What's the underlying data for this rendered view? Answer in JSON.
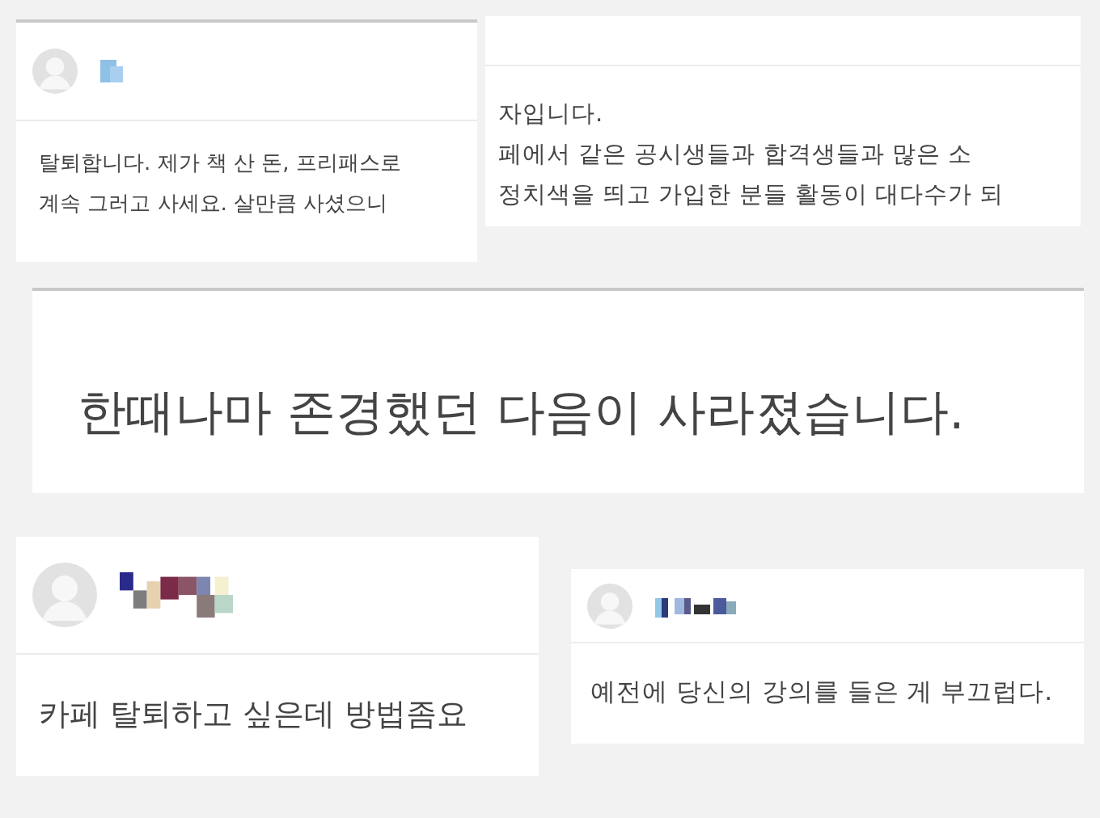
{
  "posts": [
    {
      "kind": "comment",
      "lines": [
        "탈퇴합니다. 제가 책 산 돈, 프리패스로",
        "계속 그러고 사세요. 살만큼 사셨으니"
      ]
    },
    {
      "kind": "excerpt",
      "lines": [
        "자입니다.",
        "페에서 같은 공시생들과 합격생들과 많은 소",
        "정치색을 띄고 가입한 분들 활동이 대다수가 되"
      ]
    },
    {
      "kind": "headline",
      "lines": [
        "한때나마 존경했던 다음이 사라졌습니다."
      ]
    },
    {
      "kind": "comment",
      "lines": [
        "카페 탈퇴하고 싶은데 방법좀요"
      ]
    },
    {
      "kind": "comment",
      "lines": [
        "예전에 당신의 강의를 들은 게 부끄럽다."
      ]
    }
  ]
}
